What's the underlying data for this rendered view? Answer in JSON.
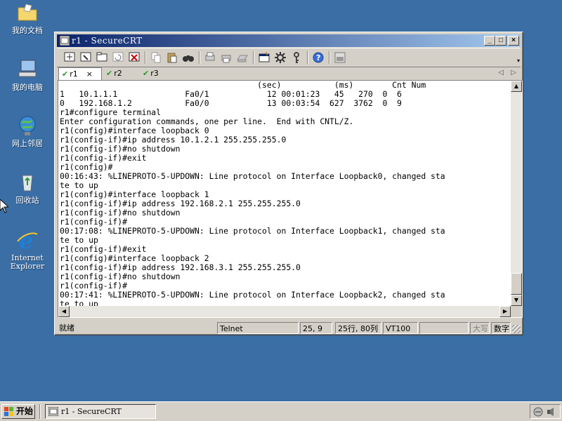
{
  "desktop": {
    "icons": [
      {
        "label": "我的文档"
      },
      {
        "label": "我的电脑"
      },
      {
        "label": "网上邻居"
      },
      {
        "label": "回收站"
      },
      {
        "label": "Internet\nExplorer"
      }
    ]
  },
  "window": {
    "title": "r1 - SecureCRT",
    "tabs": [
      {
        "label": "r1",
        "close": "×"
      },
      {
        "label": "r2"
      },
      {
        "label": "r3"
      }
    ],
    "controls": {
      "minimize": "_",
      "maximize": "□",
      "close": "×"
    }
  },
  "terminal": {
    "lines": [
      "                                         (sec)           (ms)        Cnt Num",
      "1   10.1.1.1              Fa0/1            12 00:01:23   45   270  0  6",
      "0   192.168.1.2           Fa0/0            13 00:03:54  627  3762  0  9",
      "r1#configure terminal",
      "Enter configuration commands, one per line.  End with CNTL/Z.",
      "r1(config)#interface loopback 0",
      "r1(config-if)#ip address 10.1.2.1 255.255.255.0",
      "r1(config-if)#no shutdown",
      "r1(config-if)#exit",
      "r1(config)#",
      "00:16:43: %LINEPROTO-5-UPDOWN: Line protocol on Interface Loopback0, changed sta",
      "te to up",
      "r1(config)#interface loopback 1",
      "r1(config-if)#ip address 192.168.2.1 255.255.255.0",
      "r1(config-if)#no shutdown",
      "r1(config-if)#",
      "00:17:08: %LINEPROTO-5-UPDOWN: Line protocol on Interface Loopback1, changed sta",
      "te to up",
      "r1(config-if)#exit",
      "r1(config)#interface loopback 2",
      "r1(config-if)#ip address 192.168.3.1 255.255.255.0",
      "r1(config-if)#no shutdown",
      "r1(config-if)#",
      "00:17:41: %LINEPROTO-5-UPDOWN: Line protocol on Interface Loopback2, changed sta",
      "te to up"
    ]
  },
  "statusbar": {
    "ready": "就绪",
    "protocol": "Telnet",
    "cursor_pos": "25,  9",
    "size": "25行, 80列",
    "emulation": "VT100",
    "caps": "大写",
    "num": "数字"
  },
  "taskbar": {
    "start_label": "开始",
    "task_label": "r1 - SecureCRT"
  },
  "colors": {
    "desktop": "#3a6ea5",
    "titlebar_start": "#0a246a",
    "titlebar_end": "#a6caf0",
    "chrome": "#d4d0c8"
  }
}
